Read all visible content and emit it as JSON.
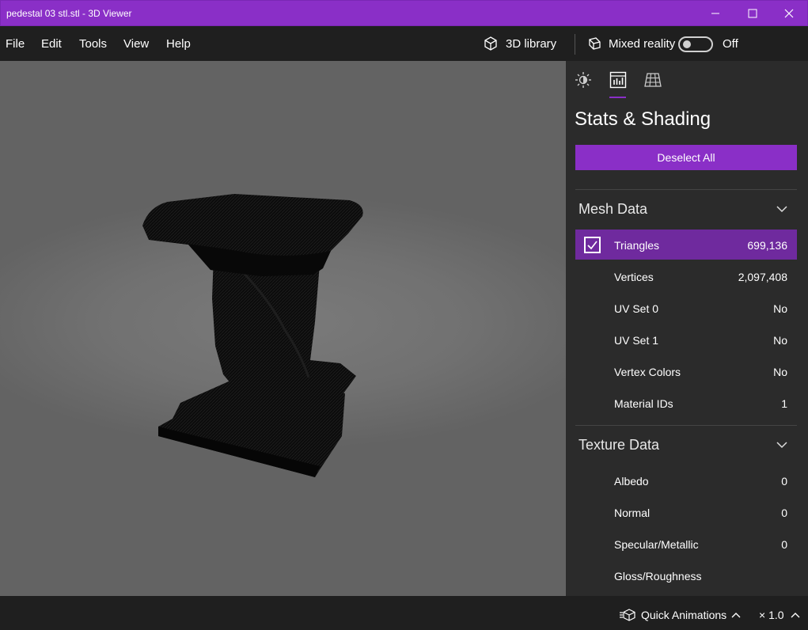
{
  "window": {
    "title": "pedestal 03 stl.stl - 3D Viewer",
    "accent_color": "#8a2fc7"
  },
  "menu": {
    "items": [
      "File",
      "Edit",
      "Tools",
      "View",
      "Help"
    ],
    "library_label": "3D library",
    "mixed_reality_label": "Mixed reality",
    "mixed_reality_state": "Off"
  },
  "panel": {
    "title": "Stats & Shading",
    "deselect_label": "Deselect All",
    "mesh_section": {
      "title": "Mesh Data",
      "rows": [
        {
          "label": "Triangles",
          "value": "699,136",
          "checked": true
        },
        {
          "label": "Vertices",
          "value": "2,097,408"
        },
        {
          "label": "UV Set 0",
          "value": "No"
        },
        {
          "label": "UV Set 1",
          "value": "No"
        },
        {
          "label": "Vertex Colors",
          "value": "No"
        },
        {
          "label": "Material IDs",
          "value": "1"
        }
      ]
    },
    "texture_section": {
      "title": "Texture Data",
      "rows": [
        {
          "label": "Albedo",
          "value": "0"
        },
        {
          "label": "Normal",
          "value": "0"
        },
        {
          "label": "Specular/Metallic",
          "value": "0"
        },
        {
          "label": "Gloss/Roughness",
          "value": ""
        }
      ]
    }
  },
  "status": {
    "quick_animations_label": "Quick Animations",
    "speed_label": "× 1.0"
  }
}
